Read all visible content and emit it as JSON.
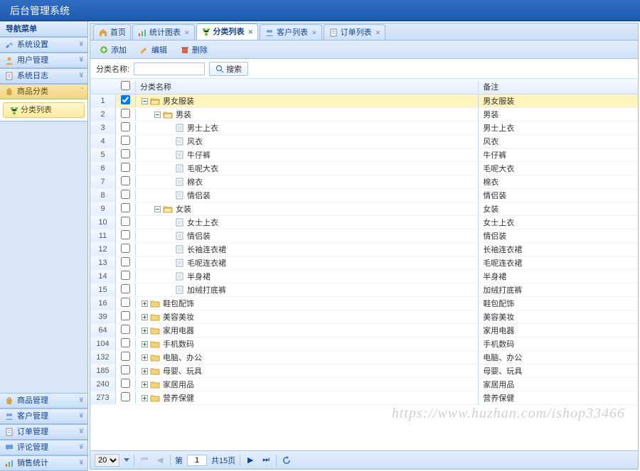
{
  "app_title": "后台管理系统",
  "sidebar": {
    "title": "导航菜单",
    "top_items": [
      {
        "label": "系统设置",
        "chev": "¥",
        "icon": "wrench"
      },
      {
        "label": "用户管理",
        "chev": "¥",
        "icon": "user"
      },
      {
        "label": "系统日志",
        "chev": "¥",
        "icon": "page"
      },
      {
        "label": "商品分类",
        "chev": "ˆ",
        "icon": "bag",
        "active": true
      }
    ],
    "active_sub": {
      "label": "分类列表",
      "icon": "tree"
    },
    "bottom_items": [
      {
        "label": "商品管理",
        "chev": "¥",
        "icon": "bag"
      },
      {
        "label": "客户管理",
        "chev": "¥",
        "icon": "users"
      },
      {
        "label": "订单管理",
        "chev": "¥",
        "icon": "order"
      },
      {
        "label": "评论管理",
        "chev": "¥",
        "icon": "chat"
      },
      {
        "label": "销售统计",
        "chev": "¥",
        "icon": "chart"
      }
    ]
  },
  "tabs": [
    {
      "label": "首页",
      "closeable": false,
      "icon": "home"
    },
    {
      "label": "统计图表",
      "closeable": true,
      "icon": "chart"
    },
    {
      "label": "分类列表",
      "closeable": true,
      "icon": "tree",
      "active": true
    },
    {
      "label": "客户列表",
      "closeable": true,
      "icon": "users"
    },
    {
      "label": "订单列表",
      "closeable": true,
      "icon": "order"
    }
  ],
  "toolbar": {
    "add": "添加",
    "edit": "编辑",
    "del": "删除"
  },
  "filter": {
    "name_label": "分类名称:",
    "search": "搜索"
  },
  "columns": {
    "name": "分类名称",
    "note": "备注"
  },
  "rows": [
    {
      "num": "1",
      "checked": true,
      "indent": 0,
      "exp": "minus",
      "icon": "folder-open",
      "name": "男女服装",
      "note": "男女服装",
      "sel": true
    },
    {
      "num": "2",
      "checked": false,
      "indent": 1,
      "exp": "minus",
      "icon": "folder-open",
      "name": "男装",
      "note": "男装"
    },
    {
      "num": "3",
      "checked": false,
      "indent": 2,
      "exp": "",
      "icon": "doc",
      "name": "男士上衣",
      "note": "男士上衣"
    },
    {
      "num": "4",
      "checked": false,
      "indent": 2,
      "exp": "",
      "icon": "doc",
      "name": "风衣",
      "note": "风衣"
    },
    {
      "num": "5",
      "checked": false,
      "indent": 2,
      "exp": "",
      "icon": "doc",
      "name": "牛仔裤",
      "note": "牛仔裤"
    },
    {
      "num": "6",
      "checked": false,
      "indent": 2,
      "exp": "",
      "icon": "doc",
      "name": "毛呢大衣",
      "note": "毛呢大衣"
    },
    {
      "num": "7",
      "checked": false,
      "indent": 2,
      "exp": "",
      "icon": "doc",
      "name": "棉衣",
      "note": "棉衣"
    },
    {
      "num": "8",
      "checked": false,
      "indent": 2,
      "exp": "",
      "icon": "doc",
      "name": "情侣装",
      "note": "情侣装"
    },
    {
      "num": "9",
      "checked": false,
      "indent": 1,
      "exp": "minus",
      "icon": "folder-open",
      "name": "女装",
      "note": "女装"
    },
    {
      "num": "10",
      "checked": false,
      "indent": 2,
      "exp": "",
      "icon": "doc",
      "name": "女士上衣",
      "note": "女士上衣"
    },
    {
      "num": "11",
      "checked": false,
      "indent": 2,
      "exp": "",
      "icon": "doc",
      "name": "情侣装",
      "note": "情侣装"
    },
    {
      "num": "12",
      "checked": false,
      "indent": 2,
      "exp": "",
      "icon": "doc",
      "name": "长袖连衣裙",
      "note": "长袖连衣裙"
    },
    {
      "num": "13",
      "checked": false,
      "indent": 2,
      "exp": "",
      "icon": "doc",
      "name": "毛呢连衣裙",
      "note": "毛呢连衣裙"
    },
    {
      "num": "14",
      "checked": false,
      "indent": 2,
      "exp": "",
      "icon": "doc",
      "name": "半身裙",
      "note": "半身裙"
    },
    {
      "num": "15",
      "checked": false,
      "indent": 2,
      "exp": "",
      "icon": "doc",
      "name": "加绒打底裤",
      "note": "加绒打底裤"
    },
    {
      "num": "16",
      "checked": false,
      "indent": 0,
      "exp": "plus",
      "icon": "folder",
      "name": "鞋包配饰",
      "note": "鞋包配饰"
    },
    {
      "num": "39",
      "checked": false,
      "indent": 0,
      "exp": "plus",
      "icon": "folder",
      "name": "美容美妆",
      "note": "美容美妆"
    },
    {
      "num": "64",
      "checked": false,
      "indent": 0,
      "exp": "plus",
      "icon": "folder",
      "name": "家用电器",
      "note": "家用电器"
    },
    {
      "num": "104",
      "checked": false,
      "indent": 0,
      "exp": "plus",
      "icon": "folder",
      "name": "手机数码",
      "note": "手机数码"
    },
    {
      "num": "132",
      "checked": false,
      "indent": 0,
      "exp": "plus",
      "icon": "folder",
      "name": "电脑、办公",
      "note": "电脑、办公"
    },
    {
      "num": "185",
      "checked": false,
      "indent": 0,
      "exp": "plus",
      "icon": "folder",
      "name": "母婴、玩具",
      "note": "母婴、玩具"
    },
    {
      "num": "240",
      "checked": false,
      "indent": 0,
      "exp": "plus",
      "icon": "folder",
      "name": "家居用品",
      "note": "家居用品"
    },
    {
      "num": "273",
      "checked": false,
      "indent": 0,
      "exp": "plus",
      "icon": "folder",
      "name": "营养保健",
      "note": "营养保健"
    }
  ],
  "pager": {
    "page_size_options": [
      "20"
    ],
    "page_size": "20",
    "page_label_prefix": "第",
    "page": "1",
    "page_label_suffix": "共15页"
  },
  "watermark": "https://www.huzhan.com/ishop33466"
}
